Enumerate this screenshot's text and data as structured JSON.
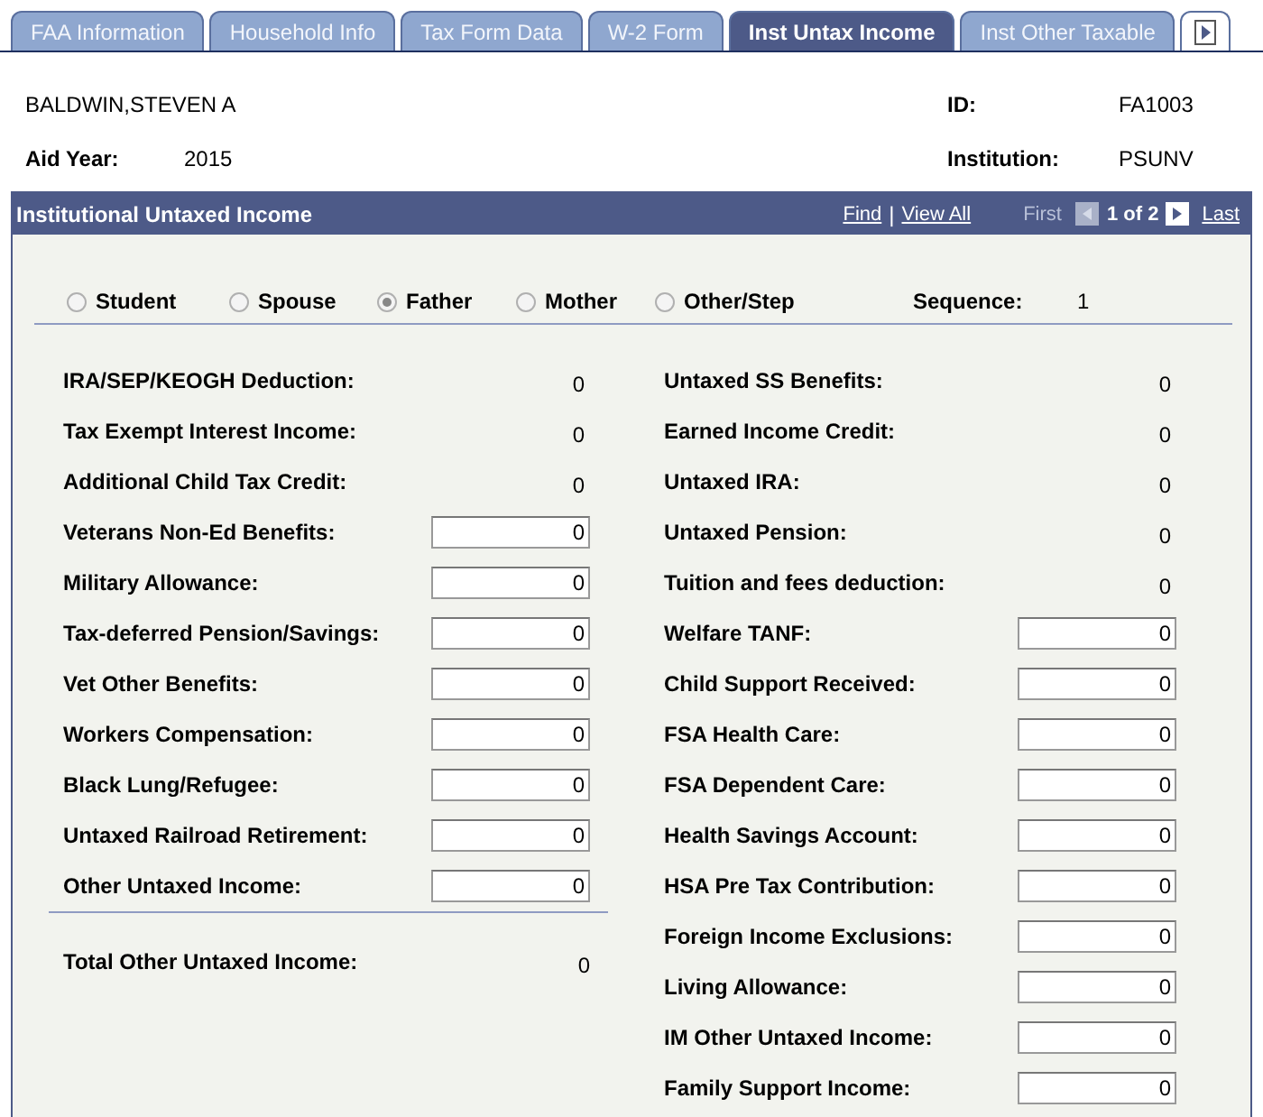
{
  "tabs": [
    {
      "label": "FAA Information",
      "selected": false
    },
    {
      "label": "Household Info",
      "selected": false
    },
    {
      "label": "Tax Form Data",
      "selected": false
    },
    {
      "label": "W-2 Form",
      "selected": false
    },
    {
      "label": "Inst Untax Income",
      "selected": true
    },
    {
      "label": "Inst Other Taxable",
      "selected": false
    }
  ],
  "header": {
    "name": "BALDWIN,STEVEN A",
    "id_label": "ID:",
    "id": "FA1003",
    "aid_year_label": "Aid Year:",
    "aid_year": "2015",
    "institution_label": "Institution:",
    "institution": "PSUNV"
  },
  "section": {
    "title": "Institutional Untaxed Income",
    "find": "Find",
    "separator": "|",
    "view_all": "View All",
    "first": "First",
    "counter": "1 of 2",
    "last": "Last"
  },
  "relationships": [
    {
      "label": "Student",
      "selected": false
    },
    {
      "label": "Spouse",
      "selected": false
    },
    {
      "label": "Father",
      "selected": true
    },
    {
      "label": "Mother",
      "selected": false
    },
    {
      "label": "Other/Step",
      "selected": false
    }
  ],
  "sequence": {
    "label": "Sequence:",
    "value": "1"
  },
  "left_fields": [
    {
      "label": "IRA/SEP/KEOGH Deduction:",
      "value": "0",
      "kind": "display"
    },
    {
      "label": "Tax Exempt Interest Income:",
      "value": "0",
      "kind": "display"
    },
    {
      "label": "Additional Child Tax Credit:",
      "value": "0",
      "kind": "display"
    },
    {
      "label": "Veterans Non-Ed Benefits:",
      "value": "0",
      "kind": "input"
    },
    {
      "label": "Military Allowance:",
      "value": "0",
      "kind": "input"
    },
    {
      "label": "Tax-deferred Pension/Savings:",
      "value": "0",
      "kind": "input"
    },
    {
      "label": "Vet Other Benefits:",
      "value": "0",
      "kind": "input"
    },
    {
      "label": "Workers Compensation:",
      "value": "0",
      "kind": "input"
    },
    {
      "label": "Black Lung/Refugee:",
      "value": "0",
      "kind": "input"
    },
    {
      "label": "Untaxed Railroad Retirement:",
      "value": "0",
      "kind": "input"
    },
    {
      "label": "Other Untaxed Income:",
      "value": "0",
      "kind": "input"
    }
  ],
  "total": {
    "label": "Total Other Untaxed Income:",
    "value": "0"
  },
  "right_fields": [
    {
      "label": "Untaxed SS Benefits:",
      "value": "0",
      "kind": "display"
    },
    {
      "label": "Earned Income Credit:",
      "value": "0",
      "kind": "display"
    },
    {
      "label": "Untaxed IRA:",
      "value": "0",
      "kind": "display"
    },
    {
      "label": "Untaxed Pension:",
      "value": "0",
      "kind": "display"
    },
    {
      "label": "Tuition and fees deduction:",
      "value": "0",
      "kind": "display"
    },
    {
      "label": "Welfare TANF:",
      "value": "0",
      "kind": "input"
    },
    {
      "label": "Child Support Received:",
      "value": "0",
      "kind": "input"
    },
    {
      "label": "FSA Health Care:",
      "value": "0",
      "kind": "input"
    },
    {
      "label": "FSA Dependent Care:",
      "value": "0",
      "kind": "input"
    },
    {
      "label": "Health Savings Account:",
      "value": "0",
      "kind": "input"
    },
    {
      "label": "HSA Pre Tax Contribution:",
      "value": "0",
      "kind": "input"
    },
    {
      "label": "Foreign Income Exclusions:",
      "value": "0",
      "kind": "input"
    },
    {
      "label": "Living Allowance:",
      "value": "0",
      "kind": "input"
    },
    {
      "label": "IM Other Untaxed Income:",
      "value": "0",
      "kind": "input"
    },
    {
      "label": "Family Support Income:",
      "value": "0",
      "kind": "input"
    }
  ]
}
